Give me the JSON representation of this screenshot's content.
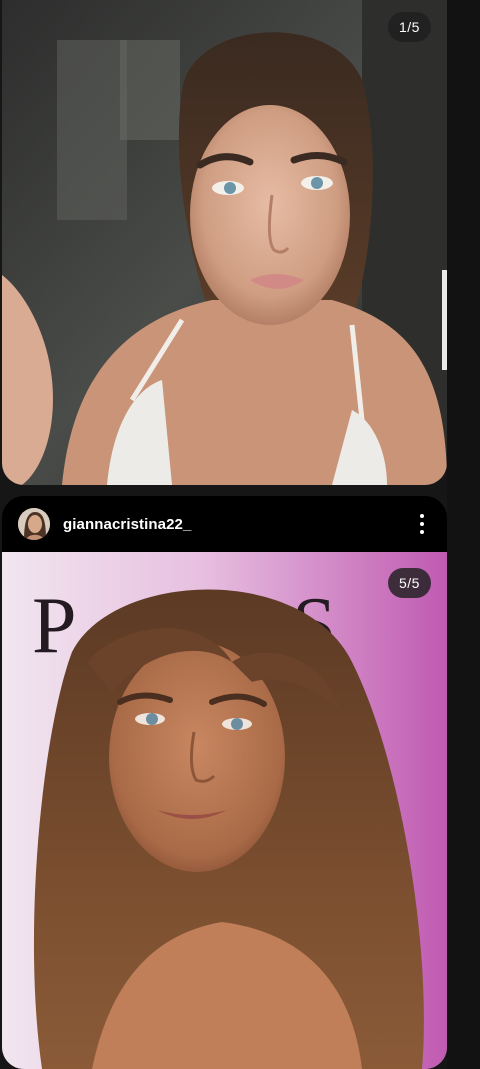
{
  "posts": [
    {
      "counter": "1/5",
      "media": "selfie-photo"
    },
    {
      "username": "giannacristina22_",
      "avatar_icon": "profile-avatar",
      "menu_icon": "more-vertical-icon",
      "counter": "5/5",
      "media": "event-portrait-photo",
      "backdrop_letters": "PS"
    }
  ],
  "colors": {
    "background": "#161616",
    "header": "#000000",
    "counter_bg": "#1e1e1e"
  }
}
